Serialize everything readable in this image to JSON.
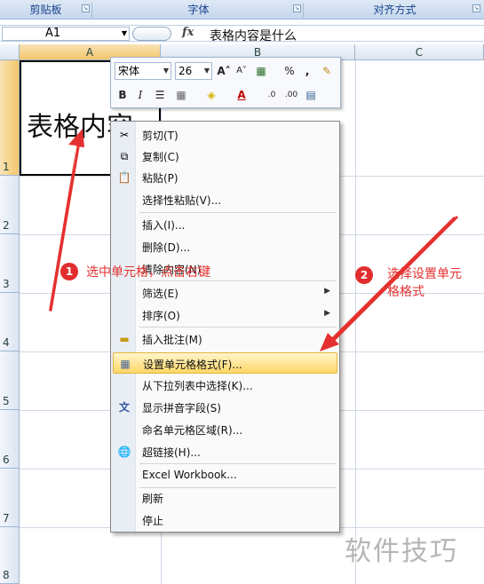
{
  "ribbon": {
    "groups": [
      "剪贴板",
      "字体",
      "对齐方式"
    ]
  },
  "formula_bar": {
    "name_box": "A1",
    "fx_label": "fx",
    "value": "表格内容是什么"
  },
  "columns": [
    "A",
    "B",
    "C"
  ],
  "rows": [
    "1",
    "2",
    "3",
    "4",
    "5",
    "6",
    "7",
    "8"
  ],
  "cell_a1": {
    "text": "表格内容"
  },
  "mini_toolbar": {
    "font": "宋体",
    "size": "26",
    "buttons": [
      "A",
      "A",
      "%",
      ",",
      "B",
      "I",
      "A"
    ]
  },
  "context_menu": {
    "items": [
      {
        "label": "剪切(T)",
        "icon": "scissors-icon"
      },
      {
        "label": "复制(C)",
        "icon": "copy-icon"
      },
      {
        "label": "粘贴(P)",
        "icon": "paste-icon"
      },
      {
        "label": "选择性粘贴(V)...",
        "icon": ""
      },
      {
        "label": "插入(I)...",
        "icon": ""
      },
      {
        "label": "删除(D)...",
        "icon": ""
      },
      {
        "label": "清除内容(N)",
        "icon": ""
      },
      {
        "label": "筛选(E)",
        "icon": ""
      },
      {
        "label": "排序(O)",
        "icon": ""
      },
      {
        "label": "插入批注(M)",
        "icon": "comment-icon"
      },
      {
        "label": "设置单元格格式(F)...",
        "icon": "format-cells-icon"
      },
      {
        "label": "从下拉列表中选择(K)...",
        "icon": ""
      },
      {
        "label": "显示拼音字段(S)",
        "icon": "phonetic-icon"
      },
      {
        "label": "命名单元格区域(R)...",
        "icon": ""
      },
      {
        "label": "超链接(H)...",
        "icon": "hyperlink-icon"
      },
      {
        "label": "Excel Workbook...",
        "icon": ""
      },
      {
        "label": "刷新",
        "icon": ""
      },
      {
        "label": "停止",
        "icon": ""
      }
    ]
  },
  "annotations": [
    {
      "number": "1",
      "text": "选中单元格，点击右键"
    },
    {
      "number": "2",
      "text_line1": "选择设置单元",
      "text_line2": "格格式"
    }
  ],
  "watermark": "软件技巧",
  "colors": {
    "annotation_red": "#e4312f",
    "highlight": "#ffd766"
  }
}
